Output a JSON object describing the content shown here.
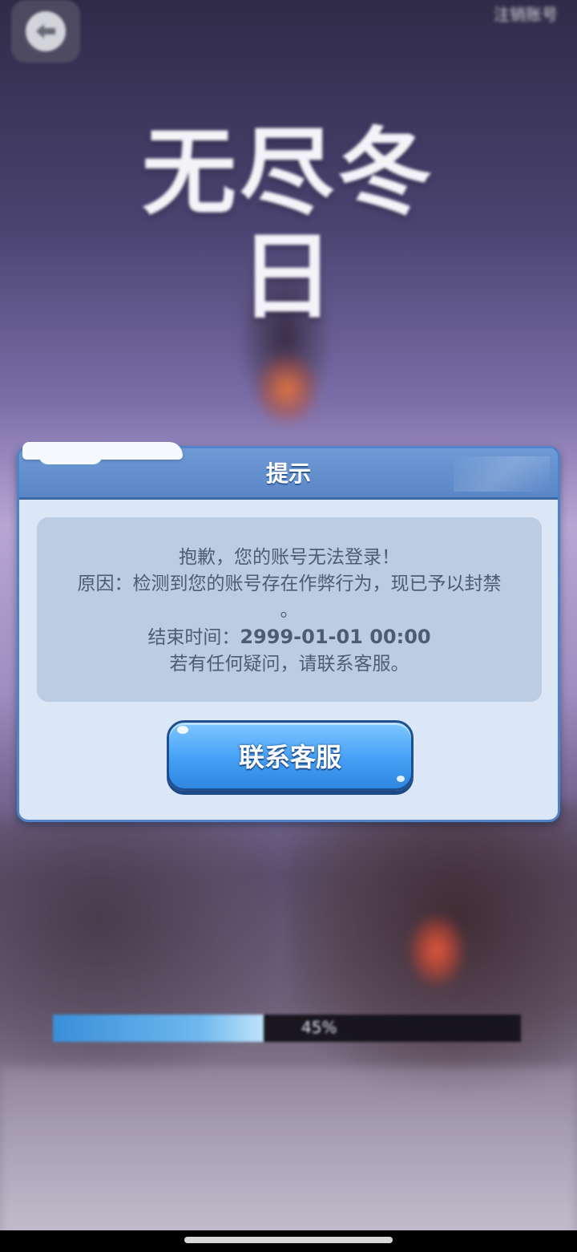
{
  "app": {
    "logo_text": "无尽冬日",
    "top_right_text": "注销账号"
  },
  "background": {
    "loading_progress_percent": 45,
    "loading_percent_text": "45%"
  },
  "dialog": {
    "title": "提示",
    "message": {
      "line1": "抱歉，您的账号无法登录！",
      "line2": "原因：检测到您的账号存在作弊行为，现已予以封禁",
      "line3": "。",
      "end_time_label": "结束时间：",
      "end_time_value": "2999-01-01 00:00",
      "line5": "若有任何疑问，请联系客服。"
    },
    "contact_button": "联系客服"
  },
  "colors": {
    "dialog_border": "#4f82c7",
    "dialog_header": "#5a86c6",
    "dialog_body": "#dbe6f6",
    "message_box": "#bccce3",
    "button_blue": "#45a1f5"
  },
  "icons": {
    "back": "back-arrow-icon"
  }
}
